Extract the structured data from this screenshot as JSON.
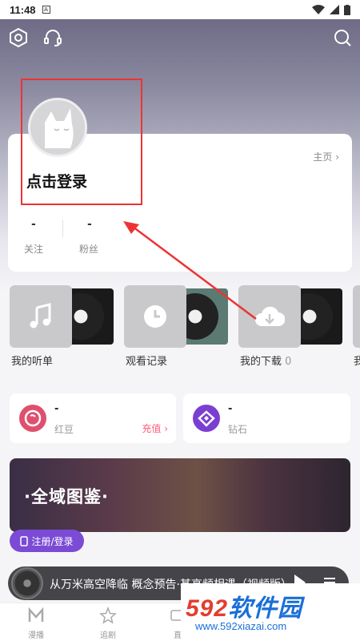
{
  "status_bar": {
    "time": "11:48"
  },
  "header": {
    "settings_icon": "hexagon-settings-icon",
    "service_icon": "headset-icon",
    "search_icon": "search-icon"
  },
  "profile": {
    "login_prompt": "点击登录",
    "homepage_link": "主页 ›",
    "stats": [
      {
        "value": "-",
        "label": "关注"
      },
      {
        "value": "-",
        "label": "粉丝"
      }
    ]
  },
  "tiles": [
    {
      "label": "我的听单",
      "icon": "music-note-icon"
    },
    {
      "label": "观看记录",
      "icon": "clock-icon"
    },
    {
      "label": "我的下载",
      "count": "0",
      "icon": "download-cloud-icon"
    },
    {
      "label": "我"
    }
  ],
  "wallet": [
    {
      "value": "-",
      "label": "红豆",
      "action": "充值 ›",
      "icon": "red-bean-icon",
      "color": "#e0506e"
    },
    {
      "value": "-",
      "label": "钻石",
      "icon": "diamond-icon",
      "color": "#7a3fd0"
    }
  ],
  "banner": {
    "title": "·全域图鉴·"
  },
  "register_button": {
    "label": "注册/登录"
  },
  "player": {
    "title": "从万米高空降临 概念预告·甚高频相遇（视频版）"
  },
  "tabbar": [
    {
      "label": "漫播",
      "icon": "m-logo-icon"
    },
    {
      "label": "追剧",
      "icon": "star-icon"
    },
    {
      "label": "直",
      "icon": "live-icon"
    }
  ],
  "watermark": {
    "brand_num": "592",
    "brand_text": "软件园",
    "url": "www.592xiazai.com"
  },
  "colors": {
    "accent": "#7b4bd6",
    "highlight_red": "#e33333",
    "recharge": "#ff5a7a"
  }
}
